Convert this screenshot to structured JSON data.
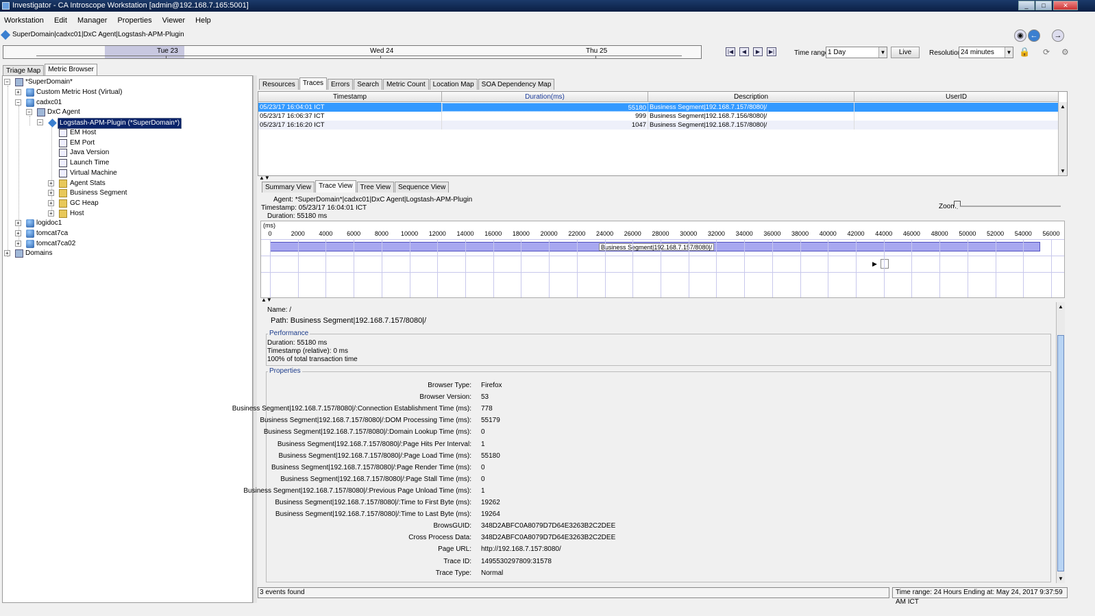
{
  "window": {
    "title": "Investigator - CA Introscope Workstation [admin@192.168.7.165:5001]"
  },
  "menu": [
    "Workstation",
    "Edit",
    "Manager",
    "Properties",
    "Viewer",
    "Help"
  ],
  "path": "SuperDomain|cadxc01|DxC Agent|Logstash-APM-Plugin",
  "timeline": {
    "labels": [
      "Tue 23",
      "Wed 24",
      "Thu 25"
    ]
  },
  "toolbar": {
    "time_range_label": "Time range:",
    "time_range_value": "1 Day",
    "live_label": "Live",
    "resolution_label": "Resolution:",
    "resolution_value": "24 minutes"
  },
  "left_tabs": [
    "Triage Map",
    "Metric Browser"
  ],
  "tree": [
    {
      "label": "*SuperDomain*",
      "icon": "domain-icon"
    },
    {
      "label": "Custom Metric Host (Virtual)",
      "icon": "host-icon"
    },
    {
      "label": "cadxc01",
      "icon": "host-icon"
    },
    {
      "label": "DxC Agent",
      "icon": "agent-icon"
    },
    {
      "label": "Logstash-APM-Plugin (*SuperDomain*)",
      "icon": "plugin-icon"
    },
    {
      "label": "EM Host",
      "icon": "metric-icon"
    },
    {
      "label": "EM Port",
      "icon": "metric-icon"
    },
    {
      "label": "Java Version",
      "icon": "metric-icon"
    },
    {
      "label": "Launch Time",
      "icon": "metric-icon"
    },
    {
      "label": "Virtual Machine",
      "icon": "metric-icon"
    },
    {
      "label": "Agent Stats",
      "icon": "folder-icon"
    },
    {
      "label": "Business Segment",
      "icon": "folder-icon"
    },
    {
      "label": "GC Heap",
      "icon": "folder-icon"
    },
    {
      "label": "Host",
      "icon": "folder-icon"
    },
    {
      "label": "logidoc1",
      "icon": "host-icon"
    },
    {
      "label": "tomcat7ca",
      "icon": "host-icon"
    },
    {
      "label": "tomcat7ca02",
      "icon": "host-icon"
    },
    {
      "label": "Domains",
      "icon": "domains-icon"
    }
  ],
  "right_tabs": [
    "Resources",
    "Traces",
    "Errors",
    "Search",
    "Metric Count",
    "Location Map",
    "SOA Dependency Map"
  ],
  "traces": {
    "columns": [
      "Timestamp",
      "Duration(ms)",
      "Description",
      "UserID"
    ],
    "rows": [
      {
        "timestamp": "05/23/17 16:04:01 ICT",
        "duration": "55180",
        "description": "Business Segment|192.168.7.157/8080|/",
        "userid": ""
      },
      {
        "timestamp": "05/23/17 16:06:37 ICT",
        "duration": "999",
        "description": "Business Segment|192.168.7.156/8080|/",
        "userid": ""
      },
      {
        "timestamp": "05/23/17 16:16:20 ICT",
        "duration": "1047",
        "description": "Business Segment|192.168.7.157/8080|/",
        "userid": ""
      }
    ]
  },
  "view_tabs": [
    "Summary View",
    "Trace View",
    "Tree View",
    "Sequence View"
  ],
  "trace_header": {
    "agent": "Agent: *SuperDomain*|cadxc01|DxC Agent|Logstash-APM-Plugin",
    "timestamp": "Timestamp: 05/23/17 16:04:01 ICT",
    "duration": "Duration: 55180 ms",
    "zoom_label": "Zoom"
  },
  "ruler": {
    "unit": "(ms)",
    "ticks": [
      "0",
      "2000",
      "4000",
      "6000",
      "8000",
      "10000",
      "12000",
      "14000",
      "16000",
      "18000",
      "20000",
      "22000",
      "24000",
      "26000",
      "28000",
      "30000",
      "32000",
      "34000",
      "36000",
      "38000",
      "40000",
      "42000",
      "44000",
      "46000",
      "48000",
      "50000",
      "52000",
      "54000",
      "56000"
    ],
    "bar_label": "Business Segment|192.168.7.157/8080|/"
  },
  "details": {
    "name": "Name: /",
    "path": "Path: Business Segment|192.168.7.157/8080|/",
    "performance_title": "Performance",
    "performance": [
      "Duration: 55180 ms",
      "Timestamp (relative): 0 ms",
      "100% of total transaction time"
    ],
    "properties_title": "Properties",
    "properties": [
      {
        "k": "Browser Type:",
        "v": "Firefox"
      },
      {
        "k": "Browser Version:",
        "v": "53"
      },
      {
        "k": "Business Segment|192.168.7.157/8080|/:Connection Establishment Time (ms):",
        "v": "778"
      },
      {
        "k": "Business Segment|192.168.7.157/8080|/:DOM Processing Time (ms):",
        "v": "55179"
      },
      {
        "k": "Business Segment|192.168.7.157/8080|/:Domain Lookup Time (ms):",
        "v": "0"
      },
      {
        "k": "Business Segment|192.168.7.157/8080|/:Page Hits Per Interval:",
        "v": "1"
      },
      {
        "k": "Business Segment|192.168.7.157/8080|/:Page Load Time (ms):",
        "v": "55180"
      },
      {
        "k": "Business Segment|192.168.7.157/8080|/:Page Render Time (ms):",
        "v": "0"
      },
      {
        "k": "Business Segment|192.168.7.157/8080|/:Page Stall Time (ms):",
        "v": "0"
      },
      {
        "k": "Business Segment|192.168.7.157/8080|/:Previous Page Unload Time (ms):",
        "v": "1"
      },
      {
        "k": "Business Segment|192.168.7.157/8080|/:Time to First Byte (ms):",
        "v": "19262"
      },
      {
        "k": "Business Segment|192.168.7.157/8080|/:Time to Last Byte (ms):",
        "v": "19264"
      },
      {
        "k": "BrowsGUID:",
        "v": "348D2ABFC0A8079D7D64E3263B2C2DEE"
      },
      {
        "k": "Cross Process Data:",
        "v": "348D2ABFC0A8079D7D64E3263B2C2DEE"
      },
      {
        "k": "Page URL:",
        "v": "http://192.168.7.157:8080/"
      },
      {
        "k": "Trace ID:",
        "v": "1495530297809:31578"
      },
      {
        "k": "Trace Type:",
        "v": "Normal"
      }
    ]
  },
  "status": {
    "events": "3 events found",
    "range": "Time range: 24 Hours     Ending at: May 24, 2017 9:37:59 AM ICT"
  }
}
